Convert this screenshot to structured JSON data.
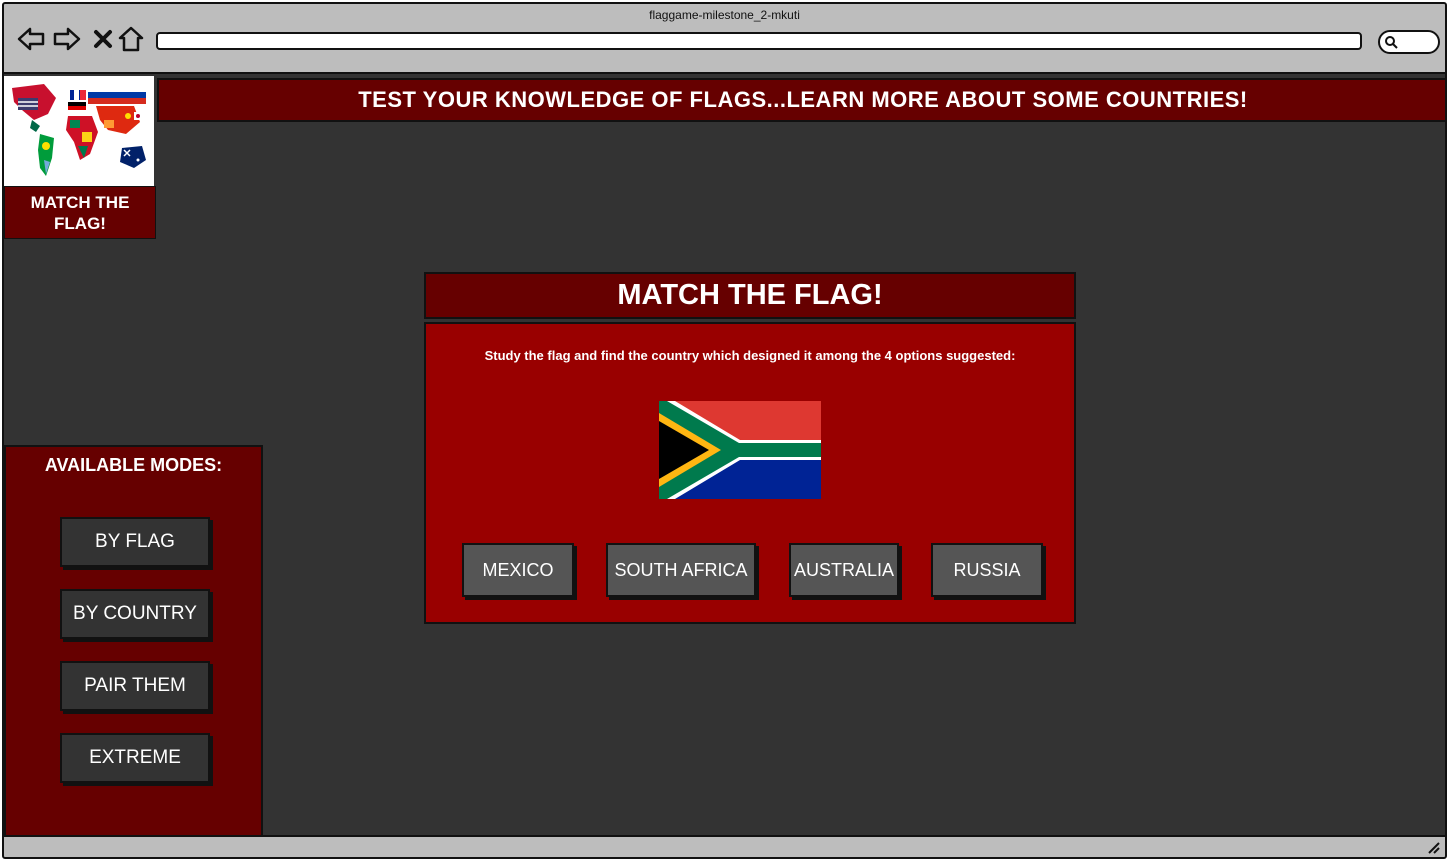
{
  "window": {
    "title": "flaggame-milestone_2-mkuti"
  },
  "browser": {
    "icons": [
      "back-icon",
      "forward-icon",
      "close-icon",
      "home-icon",
      "search-icon",
      "resize-icon"
    ]
  },
  "sidebar": {
    "logo_label": "MATCH THE FLAG!",
    "modes_title": "AVAILABLE MODES:",
    "modes": [
      {
        "label": "BY FLAG"
      },
      {
        "label": "BY COUNTRY"
      },
      {
        "label": "PAIR THEM"
      },
      {
        "label": "EXTREME"
      }
    ]
  },
  "banner": {
    "text": "TEST YOUR KNOWLEDGE OF FLAGS...LEARN MORE ABOUT SOME COUNTRIES!"
  },
  "game": {
    "title": "MATCH THE FLAG!",
    "instructions": "Study the flag and find the country which designed it among the 4 options suggested:",
    "flag_icon": "south-africa-flag-icon",
    "options": [
      {
        "label": "MEXICO"
      },
      {
        "label": "SOUTH AFRICA"
      },
      {
        "label": "AUSTRALIA"
      },
      {
        "label": "RUSSIA"
      }
    ]
  },
  "colors": {
    "dark_red": "#660000",
    "red": "#990000",
    "background": "#333333",
    "chrome": "#bdbdbd"
  }
}
